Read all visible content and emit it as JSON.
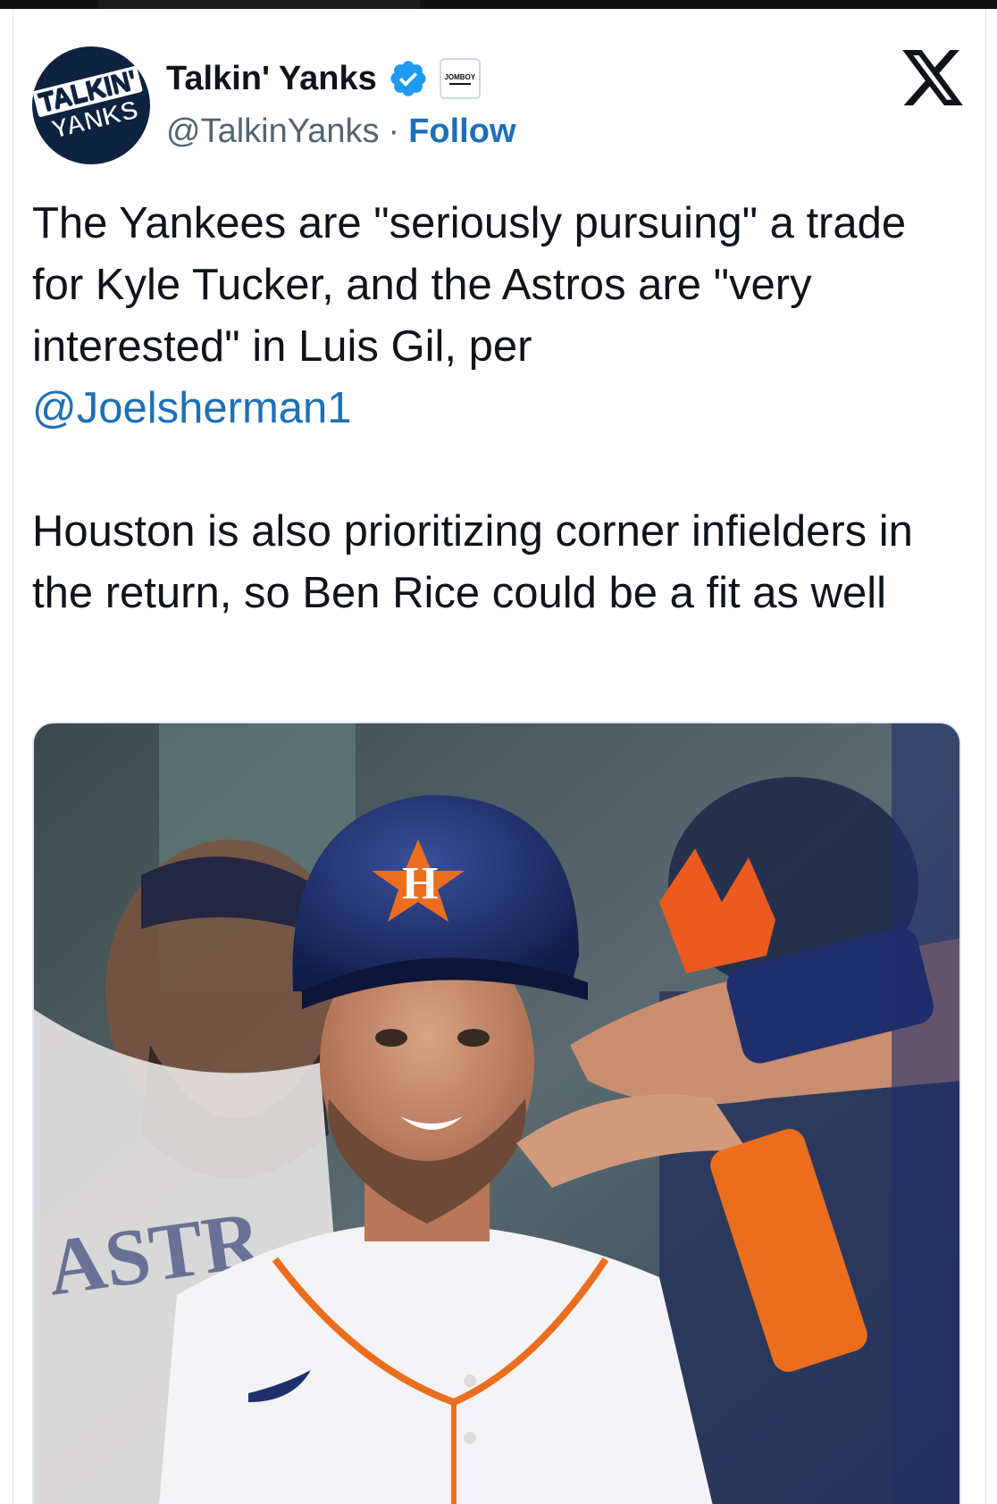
{
  "account": {
    "avatar_line1": "TALKIN'",
    "avatar_line2": "YANKS",
    "name": "Talkin' Yanks",
    "verified": true,
    "affiliate_badge": "JOMBOY",
    "handle": "@TalkinYanks",
    "separator": "·",
    "follow_label": "Follow"
  },
  "platform_icon": "x-logo-icon",
  "tweet": {
    "line1_before": "The Yankees are \"seriously pursuing\" a trade for Kyle Tucker, and the Astros are \"very interested\" in Luis Gil, per",
    "mention": "@Joelsherman1",
    "paragraph2": "Houston is also prioritizing corner infielders in the return, so Ben Rice could be a fit as well"
  },
  "media": {
    "jersey_text": "ASTR"
  },
  "colors": {
    "link": "#1d6fb8",
    "text": "#0f1419",
    "secondary": "#536471",
    "verified": "#1d9bf0",
    "astros_navy": "#1f2f6b",
    "astros_orange": "#eb6e1f"
  }
}
